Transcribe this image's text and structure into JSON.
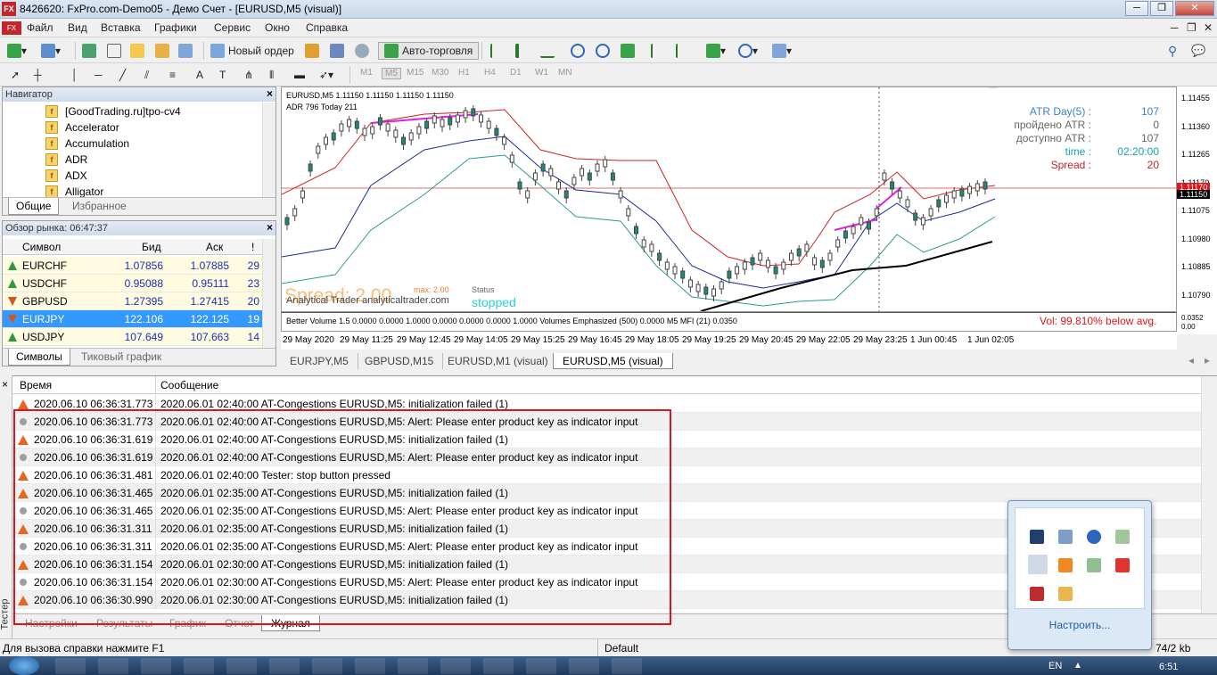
{
  "window": {
    "title": "8426620: FxPro.com-Demo05 - Демо Счет - [EURUSD,M5 (visual)]",
    "icon_text": "FX"
  },
  "menu": [
    "Файл",
    "Вид",
    "Вставка",
    "Графики",
    "Сервис",
    "Окно",
    "Справка"
  ],
  "toolbar": {
    "new_order": "Новый ордер",
    "auto_trading": "Авто-торговля"
  },
  "timeframes": [
    "M1",
    "M5",
    "M15",
    "M30",
    "H1",
    "H4",
    "D1",
    "W1",
    "MN"
  ],
  "navigator": {
    "title": "Навигатор",
    "items": [
      "[GoodTrading.ru]tpo-cv4",
      "Accelerator",
      "Accumulation",
      "ADR",
      "ADX",
      "Alligator"
    ],
    "tabs": [
      "Общие",
      "Избранное"
    ]
  },
  "market_watch": {
    "title": "Обзор рынка: 06:47:37",
    "columns": [
      "Символ",
      "Бид",
      "Аск",
      "!"
    ],
    "rows": [
      {
        "symbol": "EURCHF",
        "bid": "1.07856",
        "ask": "1.07885",
        "spread": "29"
      },
      {
        "symbol": "USDCHF",
        "bid": "0.95088",
        "ask": "0.95111",
        "spread": "23"
      },
      {
        "symbol": "GBPUSD",
        "bid": "1.27395",
        "ask": "1.27415",
        "spread": "20"
      },
      {
        "symbol": "EURJPY",
        "bid": "122.106",
        "ask": "122.125",
        "spread": "19"
      },
      {
        "symbol": "USDJPY",
        "bid": "107.649",
        "ask": "107.663",
        "spread": "14"
      }
    ],
    "tabs": [
      "Символы",
      "Тиковый график"
    ]
  },
  "chart": {
    "header_line1": "EURUSD,M5  1.11150 1.11150 1.11150 1.11150",
    "header_line2": "ADR 796  Today 211",
    "atr_panel": [
      {
        "label": "ATR Day(5) :",
        "value": "107"
      },
      {
        "label": "пройдено ATR :",
        "value": "0"
      },
      {
        "label": "доступно ATR :",
        "value": "107"
      },
      {
        "label": "time :",
        "value": "02:20:00"
      },
      {
        "label": "Spread :",
        "value": "20"
      }
    ],
    "spread_overlay": "Spread: 2.00",
    "max_label": "max: 2.00",
    "status_label": "Status",
    "status_value": "stopped",
    "watermark": "Analytical Trader analyticaltrader.com",
    "price_labels": [
      "1.11455",
      "1.11360",
      "1.11265",
      "1.11170",
      "1.11075",
      "1.10980",
      "1.10885",
      "1.10790"
    ],
    "current_price": "1.11150",
    "red_price": "1.11170",
    "sub_indicator": "Better Volume 1.5 0.0000 0.0000 1.0000 0.0000 0.0000 0.0000 1.0000  Volumes Emphasized  (500)  0.0000  M5 MFI (21) 0.0350",
    "sub_vol": "Vol:  99.810% below avg.",
    "sub_axis": [
      "0.0352",
      "0.00"
    ],
    "time_labels": [
      "29 May 2020",
      "29 May 11:25",
      "29 May 12:45",
      "29 May 14:05",
      "29 May 15:25",
      "29 May 16:45",
      "29 May 18:05",
      "29 May 19:25",
      "29 May 20:45",
      "29 May 22:05",
      "29 May 23:25",
      "1 Jun 00:45",
      "1 Jun 02:05"
    ],
    "tabs": [
      "EURJPY,M5",
      "GBPUSD,M15",
      "EURUSD,M1 (visual)",
      "EURUSD,M5 (visual)"
    ]
  },
  "journal": {
    "columns": [
      "Время",
      "Сообщение"
    ],
    "rows": [
      {
        "type": "warn",
        "time": "2020.06.10 06:36:31.773",
        "msg": "2020.06.01 02:40:00  AT-Congestions EURUSD,M5: initialization failed (1)"
      },
      {
        "type": "info",
        "time": "2020.06.10 06:36:31.773",
        "msg": "2020.06.01 02:40:00  AT-Congestions EURUSD,M5: Alert: Please enter product key as indicator input"
      },
      {
        "type": "warn",
        "time": "2020.06.10 06:36:31.619",
        "msg": "2020.06.01 02:40:00  AT-Congestions EURUSD,M5: initialization failed (1)"
      },
      {
        "type": "info",
        "time": "2020.06.10 06:36:31.619",
        "msg": "2020.06.01 02:40:00  AT-Congestions EURUSD,M5: Alert: Please enter product key as indicator input"
      },
      {
        "type": "warn",
        "time": "2020.06.10 06:36:31.481",
        "msg": "2020.06.01 02:40:00  Tester: stop button pressed"
      },
      {
        "type": "warn",
        "time": "2020.06.10 06:36:31.465",
        "msg": "2020.06.01 02:35:00  AT-Congestions EURUSD,M5: initialization failed (1)"
      },
      {
        "type": "info",
        "time": "2020.06.10 06:36:31.465",
        "msg": "2020.06.01 02:35:00  AT-Congestions EURUSD,M5: Alert: Please enter product key as indicator input"
      },
      {
        "type": "warn",
        "time": "2020.06.10 06:36:31.311",
        "msg": "2020.06.01 02:35:00  AT-Congestions EURUSD,M5: initialization failed (1)"
      },
      {
        "type": "info",
        "time": "2020.06.10 06:36:31.311",
        "msg": "2020.06.01 02:35:00  AT-Congestions EURUSD,M5: Alert: Please enter product key as indicator input"
      },
      {
        "type": "warn",
        "time": "2020.06.10 06:36:31.154",
        "msg": "2020.06.01 02:30:00  AT-Congestions EURUSD,M5: initialization failed (1)"
      },
      {
        "type": "info",
        "time": "2020.06.10 06:36:31.154",
        "msg": "2020.06.01 02:30:00  AT-Congestions EURUSD,M5: Alert: Please enter product key as indicator input"
      },
      {
        "type": "warn",
        "time": "2020.06.10 06:36:30.990",
        "msg": "2020.06.01 02:30:00  AT-Congestions EURUSD,M5: initialization failed (1)"
      }
    ],
    "tabs": [
      "Настройки",
      "Результаты",
      "График",
      "Отчет",
      "Журнал"
    ],
    "side_label": "Тестер"
  },
  "status": {
    "help": "Для вызова справки нажмите F1",
    "profile": "Default",
    "traffic": "74/2 kb"
  },
  "tray": {
    "customize": "Настроить...",
    "lang": "EN",
    "clock": "6:51"
  }
}
